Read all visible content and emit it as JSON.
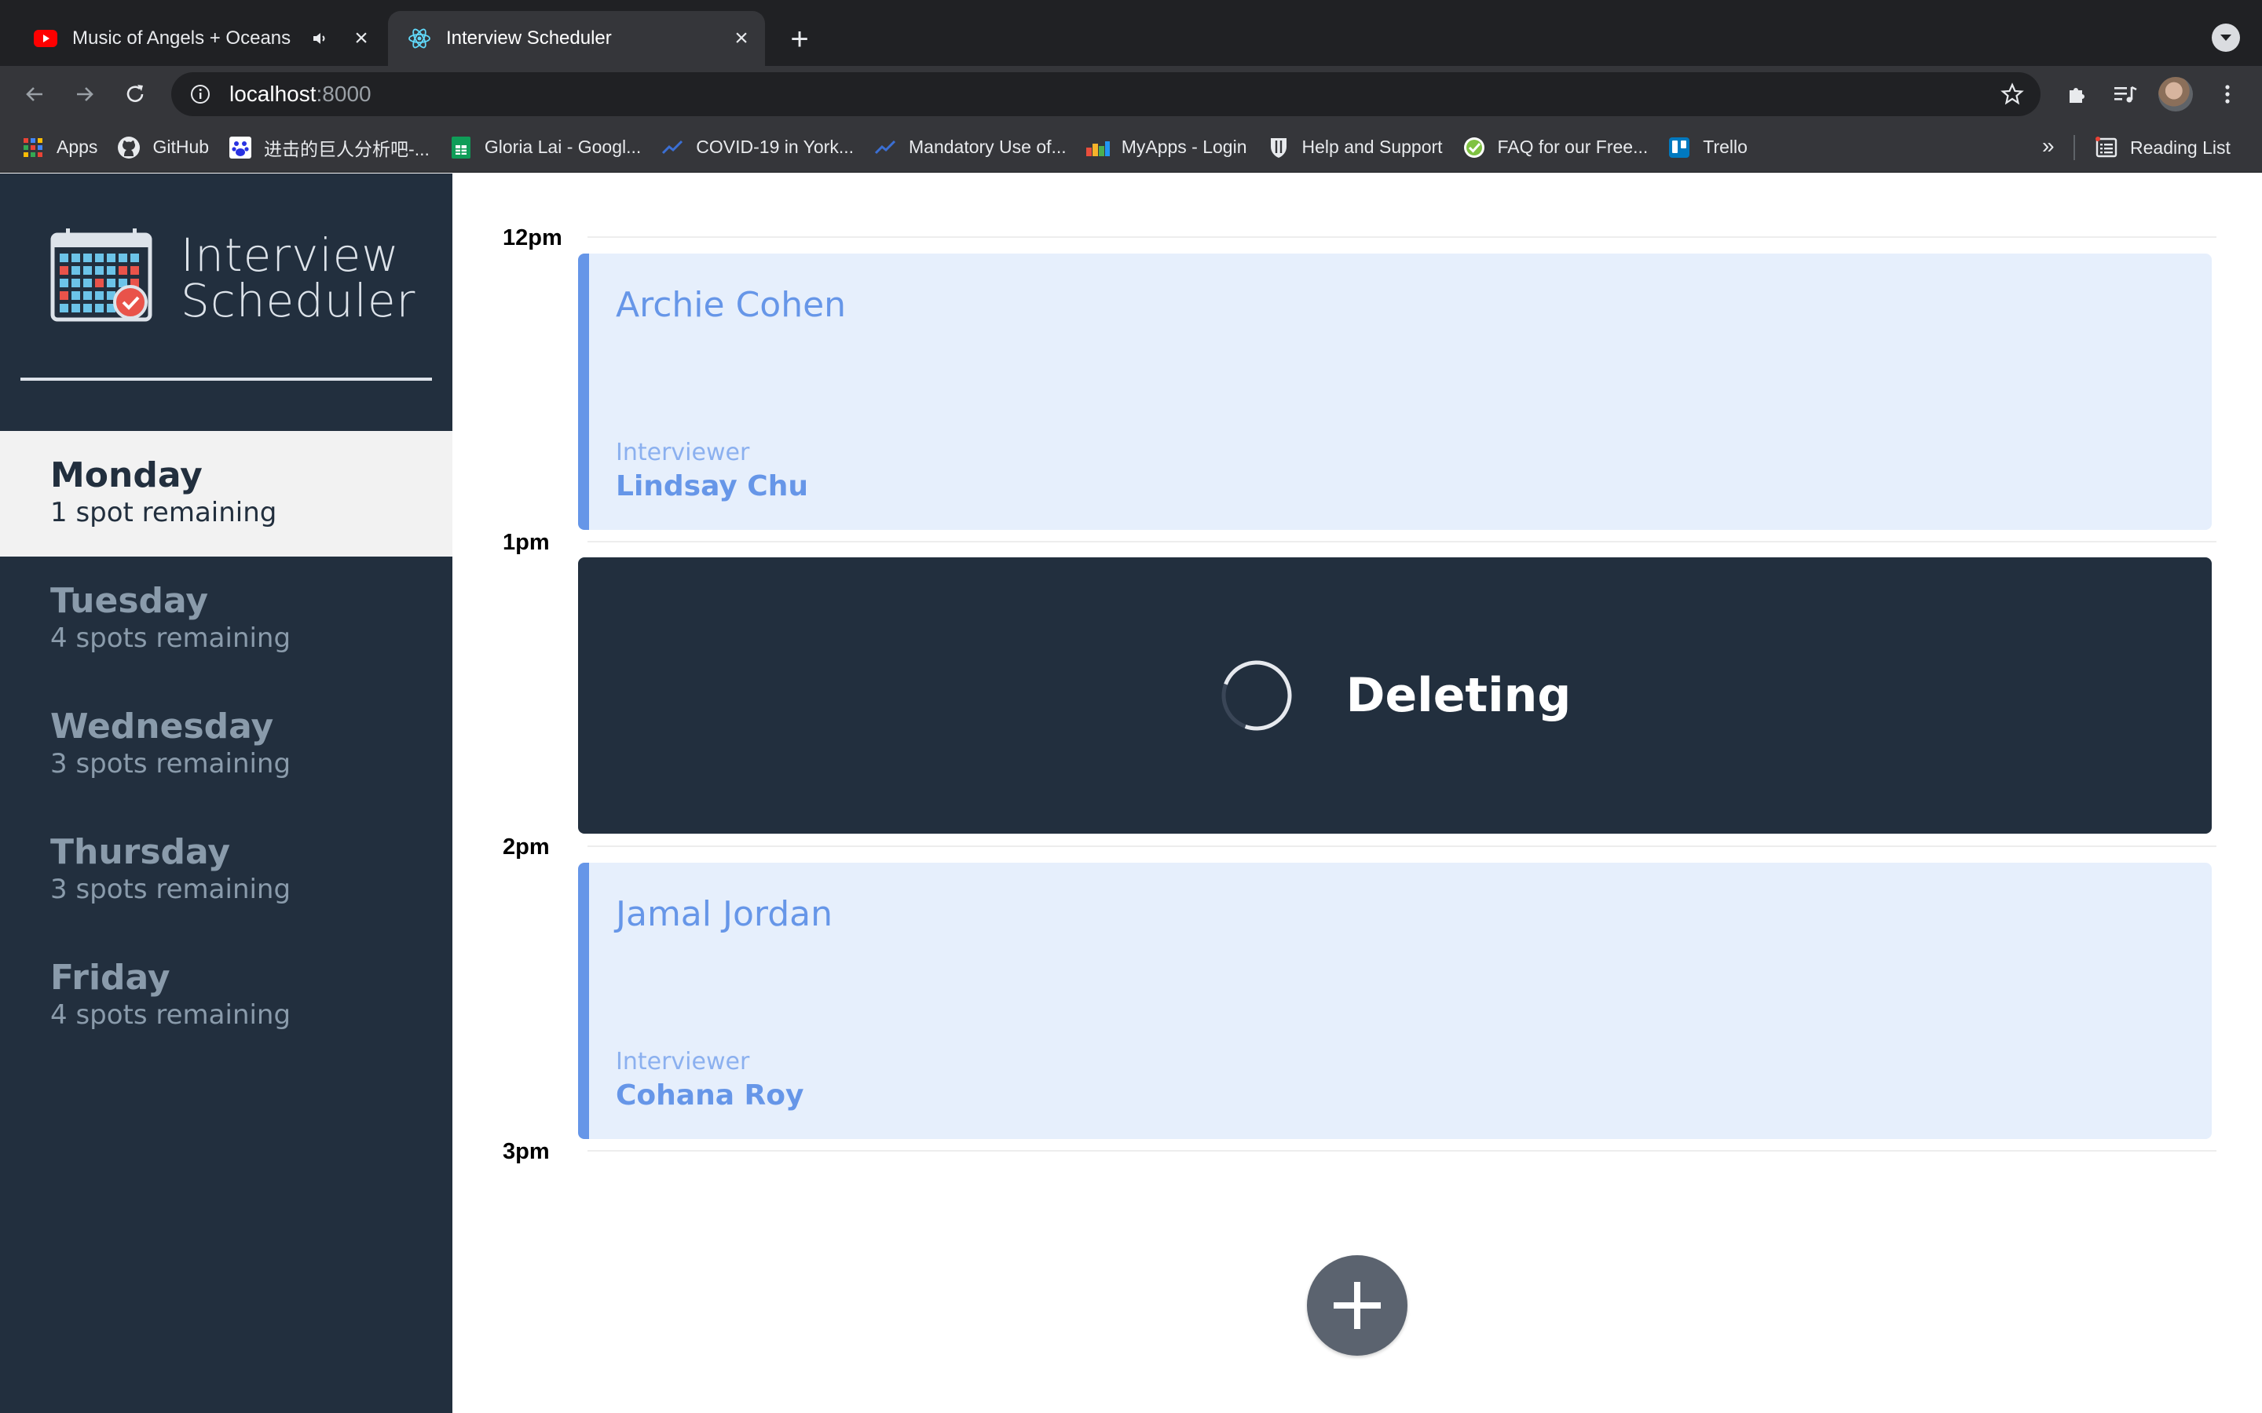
{
  "browser": {
    "tabs": [
      {
        "title": "Music of Angels + Oceans",
        "icon": "youtube-icon",
        "audio": true,
        "active": false
      },
      {
        "title": "Interview Scheduler",
        "icon": "react-icon",
        "active": true
      }
    ],
    "url_host": "localhost",
    "url_port": ":8000",
    "bookmarks": [
      {
        "label": "Apps",
        "icon": "apps-grid-icon"
      },
      {
        "label": "GitHub",
        "icon": "github-icon"
      },
      {
        "label": "进击的巨人分析吧-...",
        "icon": "baidu-icon"
      },
      {
        "label": "Gloria Lai - Googl...",
        "icon": "sheets-icon"
      },
      {
        "label": "COVID-19 in York...",
        "icon": "chart-icon"
      },
      {
        "label": "Mandatory Use of...",
        "icon": "chart-icon"
      },
      {
        "label": "MyApps - Login",
        "icon": "myapps-icon"
      },
      {
        "label": "Help and Support",
        "icon": "shield-icon"
      },
      {
        "label": "FAQ for our Free...",
        "icon": "check-badge-icon"
      },
      {
        "label": "Trello",
        "icon": "trello-icon"
      }
    ],
    "more_bookmarks": "»",
    "reading_list": "Reading List"
  },
  "app": {
    "title_line1": "Interview",
    "title_line2": "Scheduler",
    "days": [
      {
        "name": "Monday",
        "spots": "1 spot remaining",
        "selected": true
      },
      {
        "name": "Tuesday",
        "spots": "4 spots remaining",
        "selected": false
      },
      {
        "name": "Wednesday",
        "spots": "3 spots remaining",
        "selected": false
      },
      {
        "name": "Thursday",
        "spots": "3 spots remaining",
        "selected": false
      },
      {
        "name": "Friday",
        "spots": "4 spots remaining",
        "selected": false
      }
    ],
    "slots": [
      {
        "time": "12pm",
        "student": "Archie Cohen",
        "interviewer_label": "Interviewer",
        "interviewer": "Lindsay Chu"
      },
      {
        "time": "1pm",
        "status": "Deleting"
      },
      {
        "time": "2pm",
        "student": "Jamal Jordan",
        "interviewer_label": "Interviewer",
        "interviewer": "Cohana Roy"
      },
      {
        "time": "3pm"
      }
    ],
    "colors": {
      "sidebar_bg": "#222f3e",
      "selected_day_bg": "#f2f2f2",
      "appointment_bg": "#e6effc",
      "appointment_accent": "#6696e8",
      "status_bg": "#222f3e"
    }
  }
}
